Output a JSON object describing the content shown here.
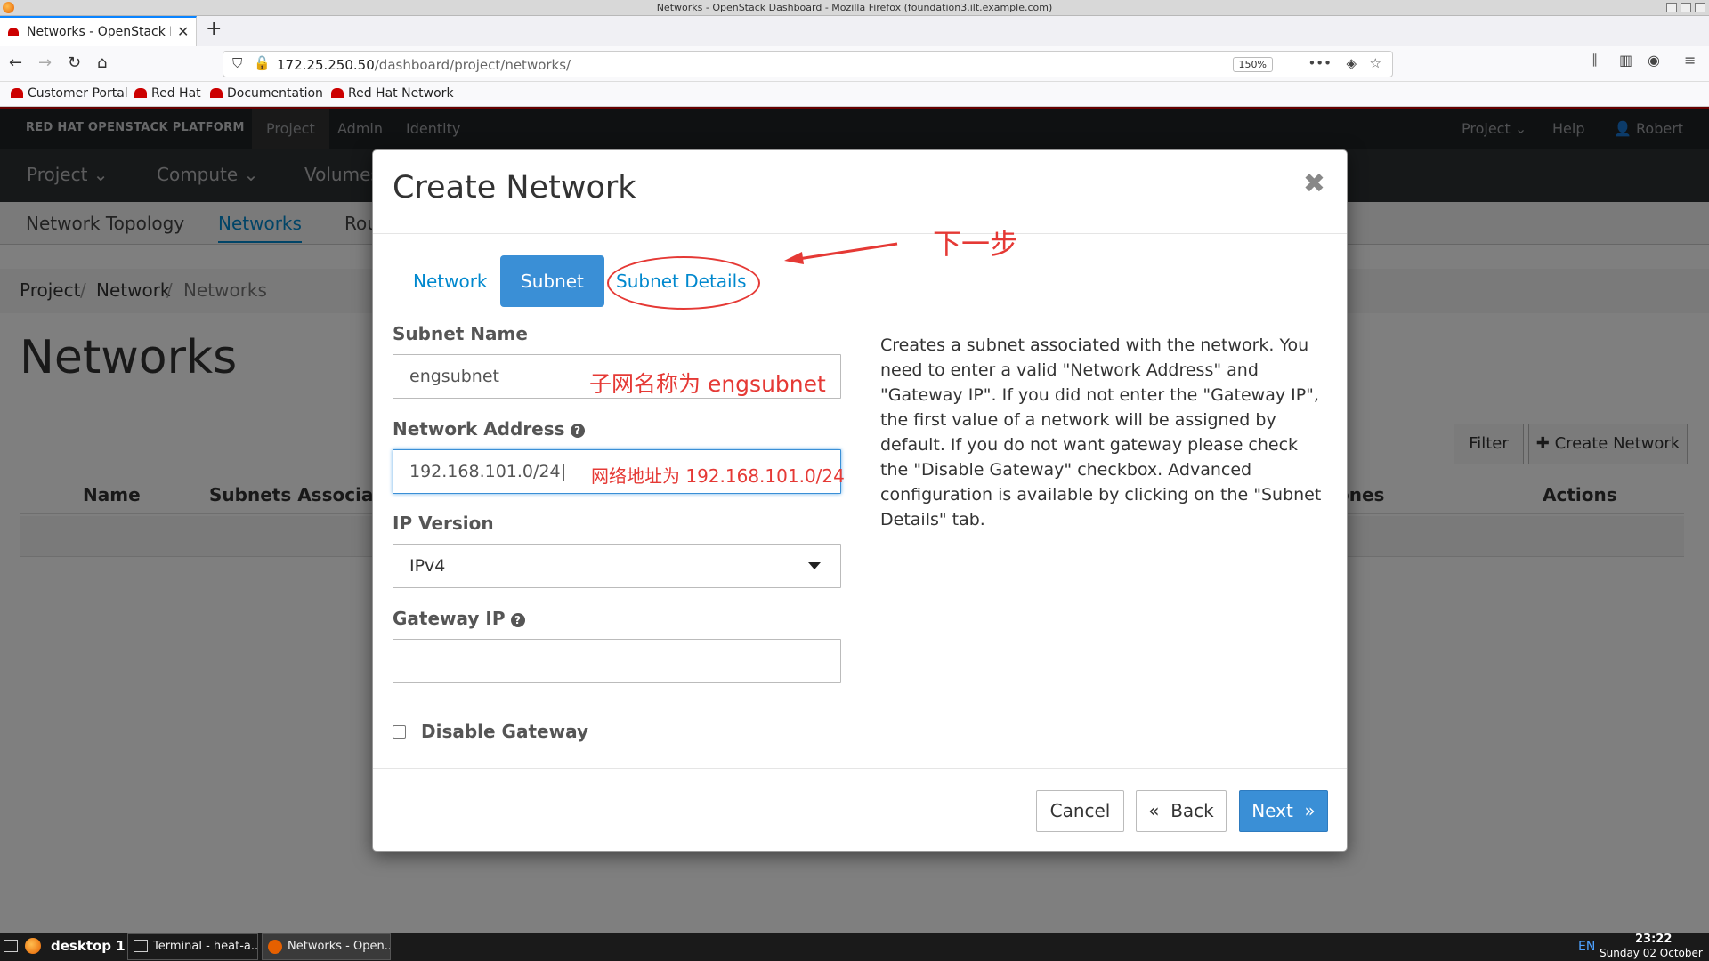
{
  "window": {
    "title": "Networks - OpenStack Dashboard - Mozilla Firefox (foundation3.ilt.example.com)"
  },
  "browser": {
    "tab_title": "Networks - OpenStack D",
    "url_host": "172.25.250.50",
    "url_path": "/dashboard/project/networks/",
    "zoom": "150%",
    "bookmarks": [
      "Customer Portal",
      "Red Hat",
      "Documentation",
      "Red Hat Network"
    ]
  },
  "masthead": {
    "brand": "RED HAT OPENSTACK PLATFORM",
    "nav": [
      "Project",
      "Admin",
      "Identity"
    ],
    "right": {
      "project": "Project",
      "help": "Help",
      "user": "Robert"
    }
  },
  "tier2": [
    "Project",
    "Compute",
    "Volumes"
  ],
  "tier3": [
    "Network Topology",
    "Networks",
    "Rou"
  ],
  "breadcrumb": [
    "Project",
    "Network",
    "Networks"
  ],
  "page_title": "Networks",
  "toolbar": {
    "filter": "Filter",
    "create": "Create Network"
  },
  "table": {
    "headers": [
      "Name",
      "Subnets Associated",
      "ones",
      "Actions"
    ]
  },
  "modal": {
    "title": "Create Network",
    "tabs": [
      "Network",
      "Subnet",
      "Subnet Details"
    ],
    "active_tab": "Subnet",
    "fields": {
      "subnet_name": {
        "label": "Subnet Name",
        "value": "engsubnet"
      },
      "network_address": {
        "label": "Network Address",
        "value": "192.168.101.0/24"
      },
      "ip_version": {
        "label": "IP Version",
        "value": "IPv4"
      },
      "gateway_ip": {
        "label": "Gateway IP",
        "value": ""
      },
      "disable_gateway": {
        "label": "Disable Gateway",
        "checked": false
      }
    },
    "help_text": "Creates a subnet associated with the network. You need to enter a valid \"Network Address\" and \"Gateway IP\". If you did not enter the \"Gateway IP\", the first value of a network will be assigned by default. If you do not want gateway please check the \"Disable Gateway\" checkbox. Advanced configuration is available by clicking on the \"Subnet Details\" tab.",
    "buttons": {
      "cancel": "Cancel",
      "back": "Back",
      "next": "Next"
    }
  },
  "annotations": {
    "next_step": "下一步",
    "subnet_name_note": "子网名称为 engsubnet",
    "network_address_note": "网络地址为 192.168.101.0/24"
  },
  "taskbar": {
    "workspace": "desktop 1",
    "tasks": [
      "Terminal - heat-a...",
      "Networks - Open..."
    ],
    "lang": "EN",
    "time": "23:22",
    "date": "Sunday 02 October"
  },
  "colors": {
    "accent": "#3a8fd6",
    "link": "#0088ce",
    "annotation": "#e53935",
    "brand_red": "#cc0000"
  }
}
